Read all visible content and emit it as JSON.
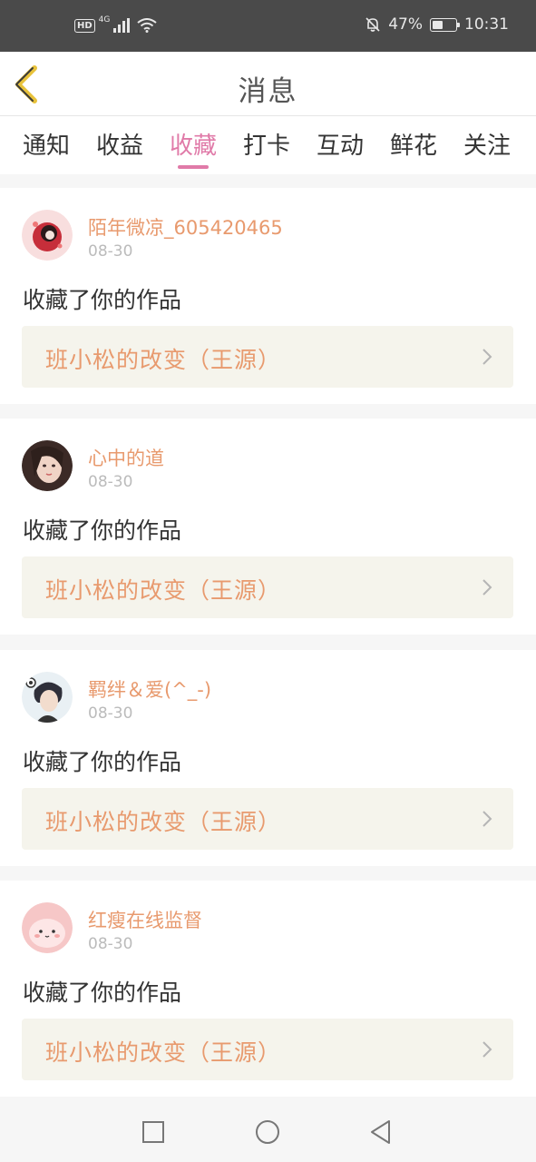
{
  "status_bar": {
    "hd": "HD",
    "network": "4G",
    "battery": "47%",
    "battery_level": 0.47,
    "time": "10:31",
    "icons": [
      "signal-icon",
      "wifi-icon",
      "mute-bell-icon",
      "battery-icon"
    ]
  },
  "header": {
    "title": "消息",
    "back_icon": "chevron-left-icon",
    "accent": "#e8c23a"
  },
  "tabs": [
    {
      "label": "通知"
    },
    {
      "label": "收益"
    },
    {
      "label": "收藏",
      "active": true
    },
    {
      "label": "打卡"
    },
    {
      "label": "互动"
    },
    {
      "label": "鲜花"
    },
    {
      "label": "关注"
    }
  ],
  "colors": {
    "active_tab": "#e07aa8",
    "name": "#e89a6e",
    "link_bg": "#f5f4ec"
  },
  "notifications": [
    {
      "user": "陌年微凉_605420465",
      "date": "08-30",
      "action": "收藏了你的作品",
      "work": "班小松的改变（王源）"
    },
    {
      "user": "心中的道",
      "date": "08-30",
      "action": "收藏了你的作品",
      "work": "班小松的改变（王源）"
    },
    {
      "user": "羁绊＆爱(^_-)",
      "date": "08-30",
      "action": "收藏了你的作品",
      "work": "班小松的改变（王源）"
    },
    {
      "user": "红瘦在线监督",
      "date": "08-30",
      "action": "收藏了你的作品",
      "work": "班小松的改变（王源）"
    }
  ],
  "nav_bar": {
    "icons": [
      "recent-apps-icon",
      "home-icon",
      "back-icon"
    ]
  }
}
